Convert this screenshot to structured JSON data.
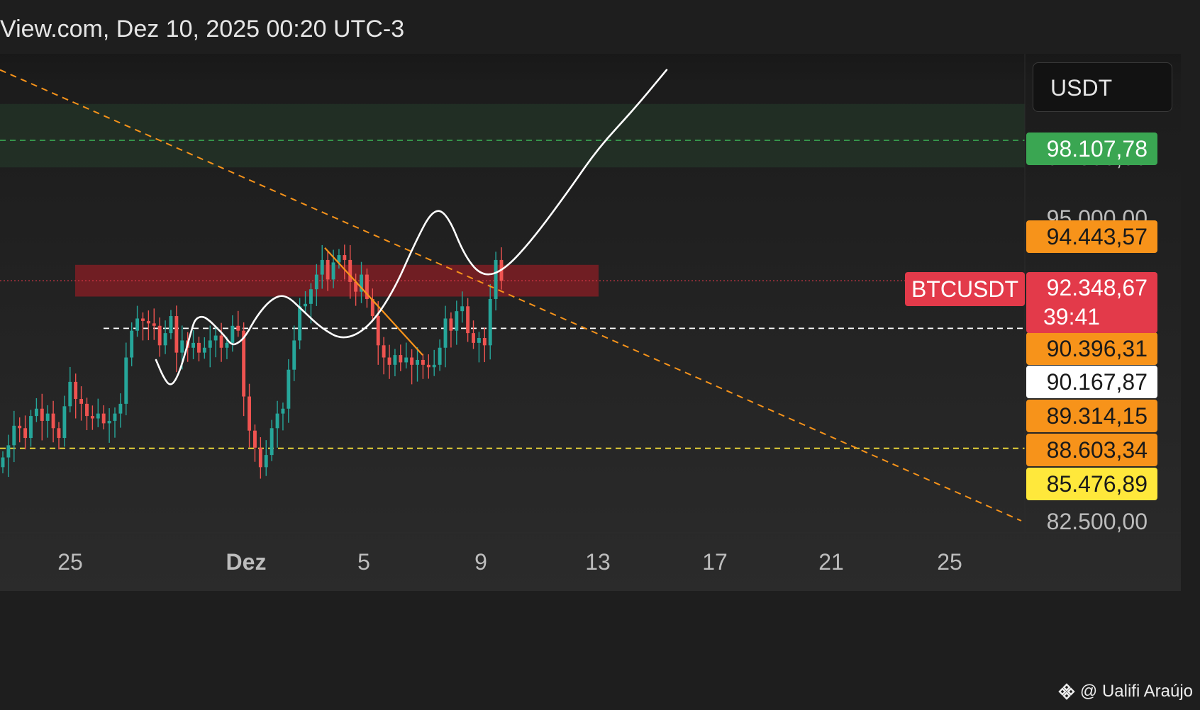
{
  "header": {
    "title": "View.com, Dez 10, 2025 00:20 UTC-3"
  },
  "currency_label": "USDT",
  "symbol_tag": "BTCUSDT",
  "last_price": {
    "value": "92.348,67",
    "countdown": "39:41",
    "color": "#e33a4a"
  },
  "price_labels": [
    {
      "id": "l98107",
      "text": "98.107,78",
      "bg": "#3aa652",
      "fg": "#ffffff"
    },
    {
      "id": "l94443",
      "text": "94.443,57",
      "bg": "#f7931a",
      "fg": "#1a1a1a"
    },
    {
      "id": "l90396",
      "text": "90.396,31",
      "bg": "#f7931a",
      "fg": "#1a1a1a"
    },
    {
      "id": "l90167",
      "text": "90.167,87",
      "bg": "#ffffff",
      "fg": "#1a1a1a"
    },
    {
      "id": "l89314",
      "text": "89.314,15",
      "bg": "#f7931a",
      "fg": "#1a1a1a"
    },
    {
      "id": "l88603",
      "text": "88.603,34",
      "bg": "#f7931a",
      "fg": "#1a1a1a"
    },
    {
      "id": "l85476",
      "text": "85.476,89",
      "bg": "#ffe83b",
      "fg": "#1a1a1a"
    }
  ],
  "axis_prices": [
    {
      "id": "a97500",
      "text": "97.500,00"
    },
    {
      "id": "a95000",
      "text": "95.000,00"
    },
    {
      "id": "a82500",
      "text": "82.500,00"
    }
  ],
  "x_ticks": [
    {
      "id": "t25a",
      "text": "25",
      "bold": false
    },
    {
      "id": "tdez",
      "text": "Dez",
      "bold": true
    },
    {
      "id": "t5",
      "text": "5",
      "bold": false
    },
    {
      "id": "t9",
      "text": "9",
      "bold": false
    },
    {
      "id": "t13",
      "text": "13",
      "bold": false
    },
    {
      "id": "t17",
      "text": "17",
      "bold": false
    },
    {
      "id": "t21",
      "text": "21",
      "bold": false
    },
    {
      "id": "t25b",
      "text": "25",
      "bold": false
    }
  ],
  "watermark": {
    "text": "@ Ualifi Araújo",
    "icon": "binance-diamond-icon"
  },
  "colors": {
    "up": "#26a69a",
    "down": "#ef5350",
    "green_zone": "#3aa652",
    "red_zone": "#8b1d24",
    "trendline": "#f7931a",
    "support_yellow": "#ffe83b",
    "projection": "#ffffff"
  },
  "chart_data": {
    "type": "candlestick",
    "title": "",
    "symbol": "BTCUSDT",
    "quote_currency": "USDT",
    "timestamp": "Dez 10, 2025 00:20 UTC-3",
    "x_ticks": [
      "25",
      "Dez",
      "5",
      "9",
      "13",
      "17",
      "21",
      "25"
    ],
    "y_axis_ticks": [
      97500,
      95000,
      82500
    ],
    "last_price": 92348.67,
    "candle_close_prices": [
      85100,
      85600,
      86400,
      86300,
      85900,
      86800,
      87100,
      86600,
      86900,
      86300,
      85900,
      87200,
      88200,
      87500,
      87300,
      86800,
      86700,
      86900,
      86500,
      86600,
      86900,
      87300,
      89200,
      90300,
      90800,
      90700,
      90600,
      90500,
      89700,
      90200,
      90900,
      89400,
      89900,
      89600,
      89800,
      89400,
      89600,
      89900,
      90100,
      89600,
      89800,
      90500,
      90300,
      87600,
      86200,
      85500,
      84700,
      85200,
      86300,
      86900,
      87100,
      88700,
      89900,
      91300,
      91400,
      92000,
      92600,
      93200,
      92400,
      93100,
      93400,
      93200,
      92300,
      91900,
      92600,
      91600,
      90900,
      89700,
      89200,
      88900,
      89300,
      89000,
      89200,
      88900,
      89100,
      88900,
      88800,
      88900,
      89600,
      90800,
      90300,
      91100,
      91300,
      90200,
      89800,
      90000,
      89700,
      91600,
      93200,
      92348.67
    ],
    "price_levels": [
      98107.78,
      94443.57,
      92348.67,
      90396.31,
      90167.87,
      89314.15,
      88603.34,
      85476.89
    ],
    "zones": [
      {
        "type": "resistance",
        "from": 97000,
        "to": 99600
      },
      {
        "type": "supply",
        "from": 91700,
        "to": 93000
      }
    ],
    "dashed_levels": [
      98107.78,
      90396.31,
      85476.89
    ],
    "trendlines": [
      {
        "style": "dashed",
        "from": {
          "price": 101000
        },
        "to": {
          "x": "25",
          "price": 82500
        }
      },
      {
        "style": "solid",
        "from": {
          "x": "5",
          "price": 93700
        },
        "to": {
          "price": 89300
        }
      }
    ],
    "projection": {
      "style": "curve",
      "ends_near": 101000
    },
    "grid": false,
    "legend": "none"
  }
}
